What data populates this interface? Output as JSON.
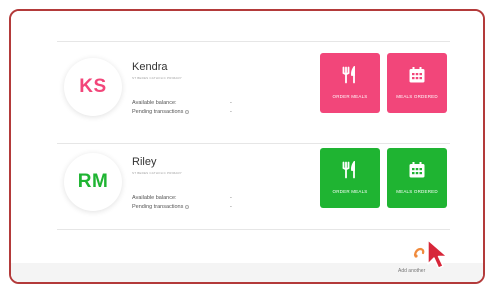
{
  "colors": {
    "frame_border": "#b33a3a",
    "kendra_accent": "#f2467a",
    "riley_accent": "#1fb432",
    "cursor": "#d72639"
  },
  "children": [
    {
      "initials": "KS",
      "name": "Kendra",
      "school": "ST BEDES CATHOLIC PRIMARY",
      "available_balance_label": "Available balance:",
      "available_balance_value": "-",
      "pending_transactions_label": "Pending transactions",
      "pending_transactions_value": "-",
      "order_meals_label": "ORDER MEALS",
      "meals_ordered_label": "MEALS ORDERED",
      "order_icon": "cutlery-icon",
      "ordered_icon": "calendar-icon"
    },
    {
      "initials": "RM",
      "name": "Riley",
      "school": "ST BEDES CATHOLIC PRIMARY",
      "available_balance_label": "Available balance:",
      "available_balance_value": "-",
      "pending_transactions_label": "Pending transactions",
      "pending_transactions_value": "-",
      "order_meals_label": "ORDER MEALS",
      "meals_ordered_label": "MEALS ORDERED",
      "order_icon": "cutlery-icon",
      "ordered_icon": "calendar-icon"
    }
  ],
  "footer": {
    "add_another_label": "Add another",
    "add_icon": "add-child-icon",
    "cursor_icon": "mouse-pointer-icon"
  }
}
